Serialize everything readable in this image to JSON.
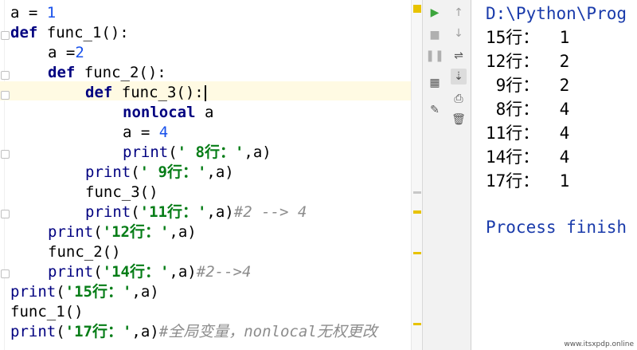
{
  "editor": {
    "lines": [
      {
        "indent": 0,
        "parts": [
          [
            "plain",
            "a = "
          ],
          [
            "num",
            "1"
          ]
        ]
      },
      {
        "indent": 0,
        "parts": [
          [
            "kw",
            "def "
          ],
          [
            "plain",
            "func_1():"
          ]
        ]
      },
      {
        "indent": 1,
        "parts": [
          [
            "plain",
            "a ="
          ],
          [
            "num",
            "2"
          ]
        ]
      },
      {
        "indent": 1,
        "parts": [
          [
            "kw",
            "def "
          ],
          [
            "plain",
            "func_2():"
          ]
        ]
      },
      {
        "indent": 2,
        "parts": [
          [
            "kw",
            "def "
          ],
          [
            "plain",
            "func_3():"
          ]
        ],
        "caret": true
      },
      {
        "indent": 3,
        "parts": [
          [
            "kw",
            "nonlocal "
          ],
          [
            "plain",
            "a"
          ]
        ]
      },
      {
        "indent": 3,
        "parts": [
          [
            "plain",
            "a = "
          ],
          [
            "num",
            "4"
          ]
        ]
      },
      {
        "indent": 3,
        "parts": [
          [
            "fn",
            "print"
          ],
          [
            "plain",
            "("
          ],
          [
            "str",
            "' 8行：'"
          ],
          [
            "plain",
            ",a)"
          ]
        ]
      },
      {
        "indent": 2,
        "parts": [
          [
            "fn",
            "print"
          ],
          [
            "plain",
            "("
          ],
          [
            "str",
            "' 9行：'"
          ],
          [
            "plain",
            ",a)"
          ]
        ]
      },
      {
        "indent": 2,
        "parts": [
          [
            "plain",
            "func_3()"
          ]
        ]
      },
      {
        "indent": 2,
        "parts": [
          [
            "fn",
            "print"
          ],
          [
            "plain",
            "("
          ],
          [
            "str",
            "'11行：'"
          ],
          [
            "plain",
            ",a)"
          ],
          [
            "cmt",
            "#2 --> 4"
          ]
        ]
      },
      {
        "indent": 1,
        "parts": [
          [
            "fn",
            "print"
          ],
          [
            "plain",
            "("
          ],
          [
            "str",
            "'12行：'"
          ],
          [
            "plain",
            ",a)"
          ]
        ]
      },
      {
        "indent": 1,
        "parts": [
          [
            "plain",
            "func_2()"
          ]
        ]
      },
      {
        "indent": 1,
        "parts": [
          [
            "fn",
            "print"
          ],
          [
            "plain",
            "("
          ],
          [
            "str",
            "'14行：'"
          ],
          [
            "plain",
            ",a)"
          ],
          [
            "cmt",
            "#2-->4"
          ]
        ]
      },
      {
        "indent": 0,
        "parts": [
          [
            "fn",
            "print"
          ],
          [
            "plain",
            "("
          ],
          [
            "str",
            "'15行：'"
          ],
          [
            "plain",
            ",a)"
          ]
        ]
      },
      {
        "indent": 0,
        "parts": [
          [
            "plain",
            "func_1()"
          ]
        ]
      },
      {
        "indent": 0,
        "parts": [
          [
            "fn",
            "print"
          ],
          [
            "plain",
            "("
          ],
          [
            "str",
            "'17行：'"
          ],
          [
            "plain",
            ",a)"
          ],
          [
            "cmt",
            "#全局变量，nonlocal无权更改"
          ]
        ]
      }
    ]
  },
  "run_toolbar": {
    "icons": [
      "run-icon",
      "stop-icon",
      "pause-icon",
      "layout-icon",
      "pin-icon"
    ]
  },
  "console_toolbar": {
    "icons": [
      "up-arrow-icon",
      "down-arrow-icon",
      "soft-wrap-icon",
      "scroll-to-end-icon",
      "print-icon",
      "trash-icon"
    ]
  },
  "console": {
    "path": "D:\\Python\\Prog",
    "output": [
      "15行：  1",
      "12行：  2",
      " 9行：  2",
      " 8行：  4",
      "11行：  4",
      "14行：  4",
      "17行：  1"
    ],
    "status": "Process finish"
  },
  "watermark": "www.itsxpdp.online",
  "colors": {
    "keyword": "#000080",
    "string": "#067d17",
    "number": "#1750eb",
    "comment": "#8c8c8c",
    "console_blue": "#1a3bab"
  }
}
